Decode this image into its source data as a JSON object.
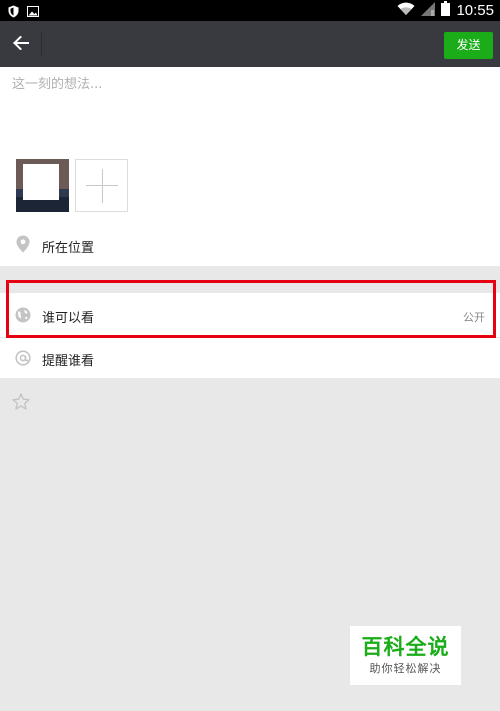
{
  "status_bar": {
    "time": "10:55",
    "icons": [
      "shield-icon",
      "image-icon",
      "wifi-icon",
      "signal-icon",
      "battery-icon"
    ]
  },
  "toolbar": {
    "back_icon": "arrow-left-icon",
    "send_label": "发送",
    "send_color": "#1aad19",
    "background": "#393a3f"
  },
  "compose": {
    "placeholder": "这一刻的想法...",
    "value": ""
  },
  "photos": {
    "add_icon": "plus-icon"
  },
  "rows": {
    "location": {
      "icon": "location-pin-icon",
      "label": "所在位置"
    },
    "visibility": {
      "icon": "globe-icon",
      "label": "谁可以看",
      "value": "公开"
    },
    "mention": {
      "icon": "at-icon",
      "label": "提醒谁看"
    },
    "favorite": {
      "icon": "star-icon"
    }
  },
  "highlight": {
    "color": "#e60012"
  },
  "watermark": {
    "title": "百科全说",
    "subtitle": "助你轻松解决"
  }
}
